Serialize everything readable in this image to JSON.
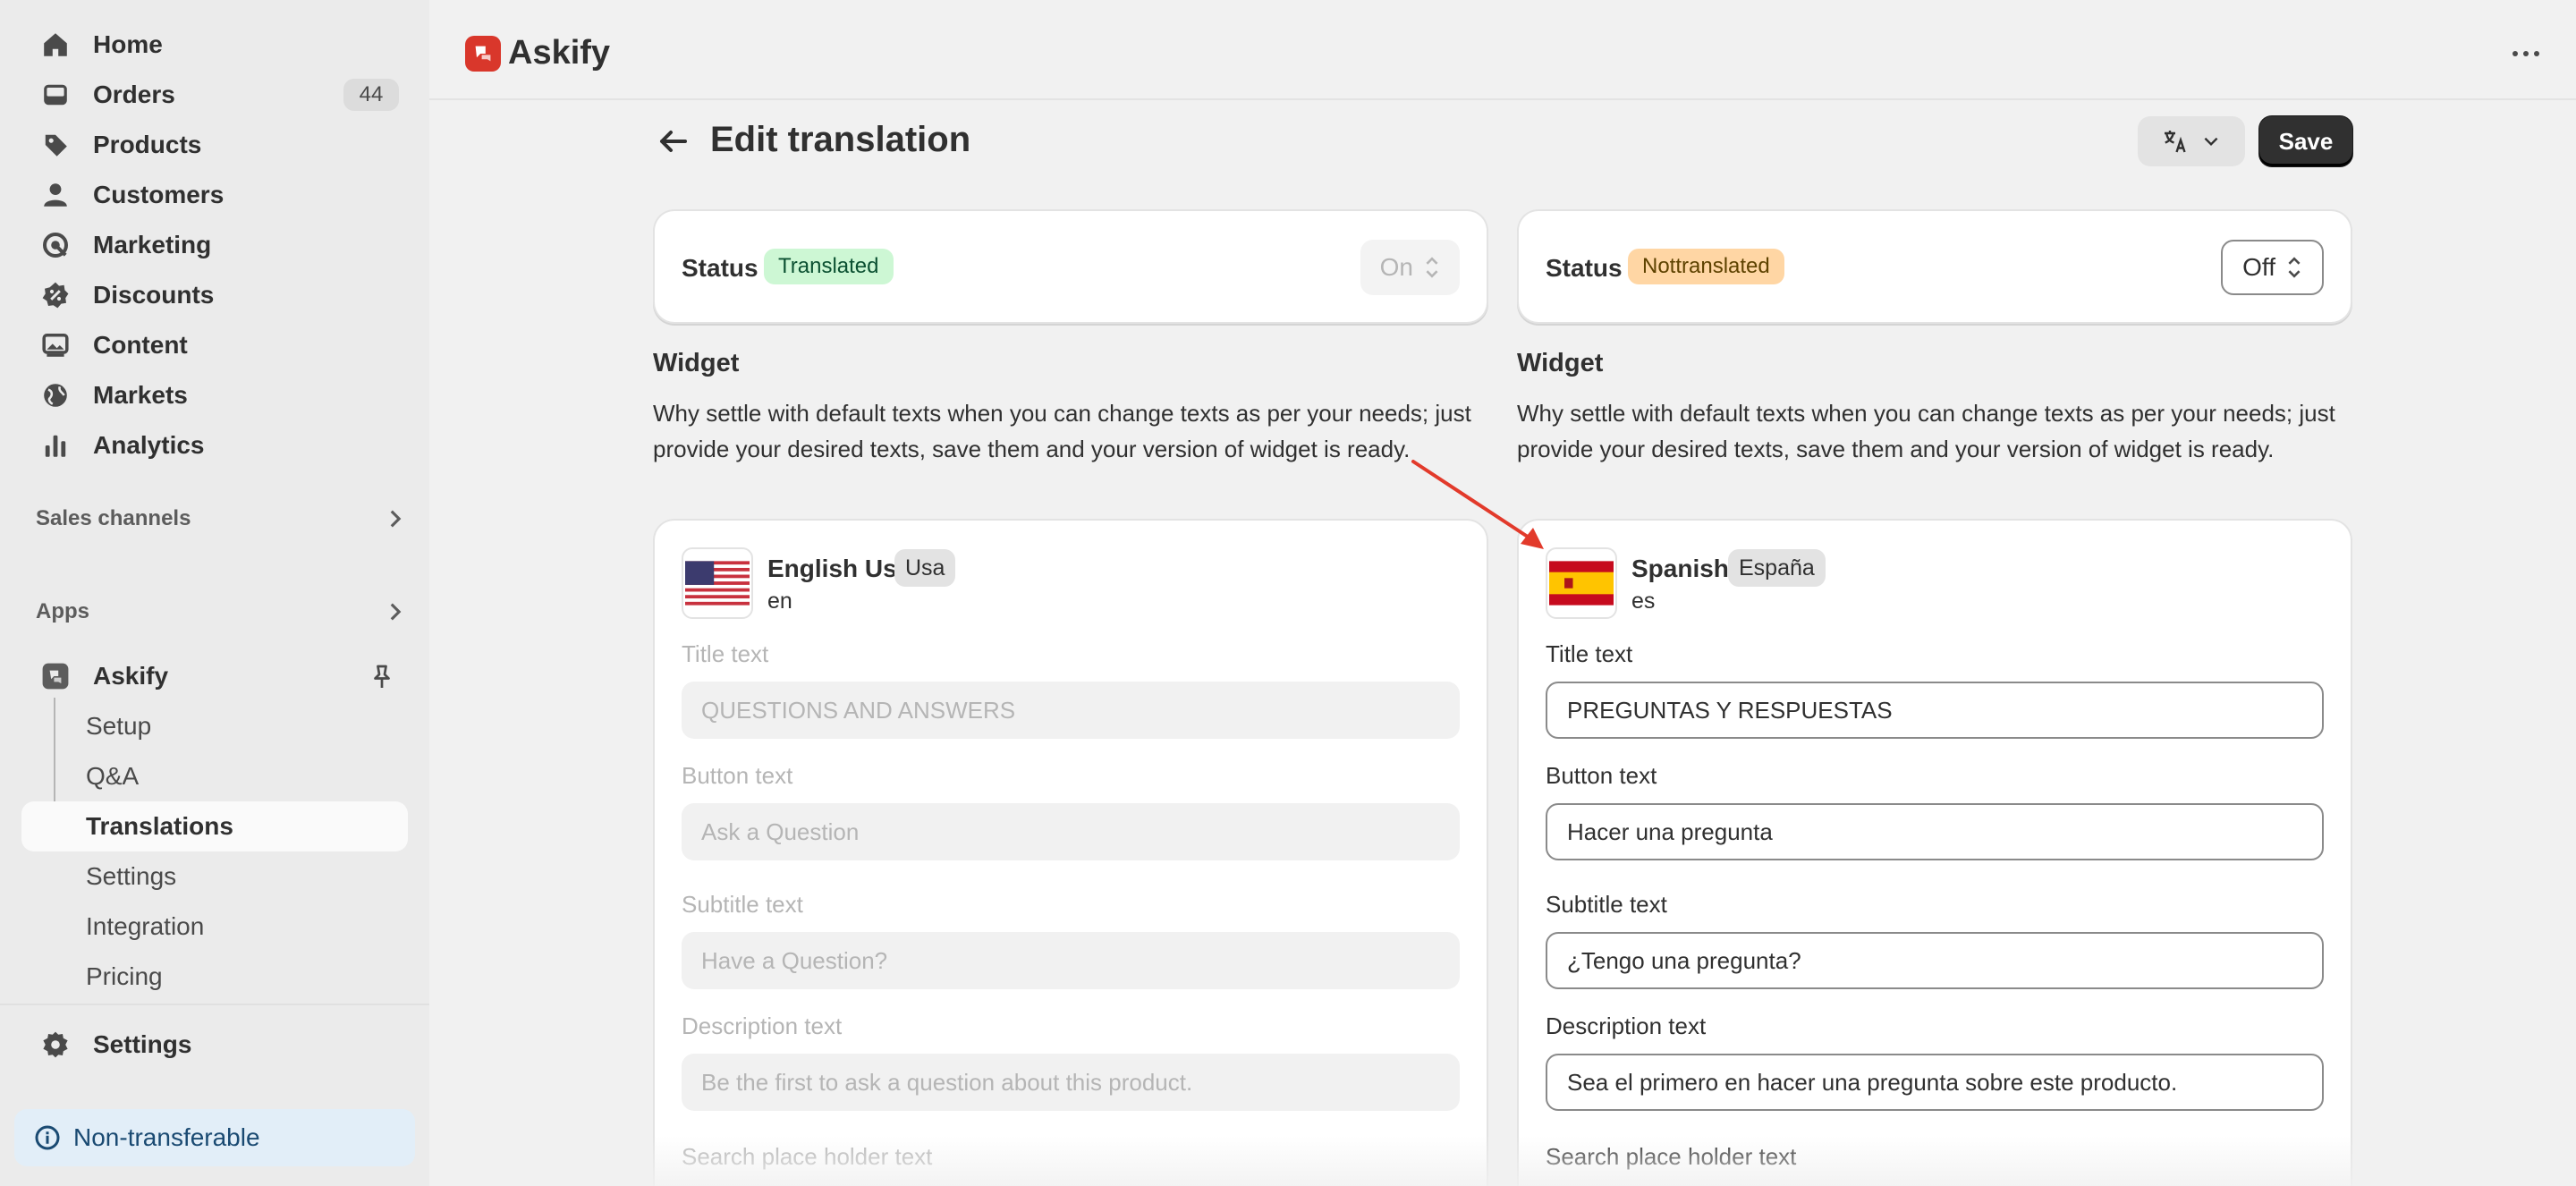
{
  "sidebar": {
    "nav": [
      {
        "label": "Home",
        "icon": "home-icon"
      },
      {
        "label": "Orders",
        "icon": "inbox-icon",
        "count": "44"
      },
      {
        "label": "Products",
        "icon": "tag-icon"
      },
      {
        "label": "Customers",
        "icon": "person-icon"
      },
      {
        "label": "Marketing",
        "icon": "target-icon"
      },
      {
        "label": "Discounts",
        "icon": "discount-icon"
      },
      {
        "label": "Content",
        "icon": "image-icon"
      },
      {
        "label": "Markets",
        "icon": "globe-icon"
      },
      {
        "label": "Analytics",
        "icon": "bar-chart-icon"
      }
    ],
    "sales_channels": "Sales channels",
    "apps": "Apps",
    "app_name": "Askify",
    "app_sub": [
      "Setup",
      "Q&A",
      "Translations",
      "Settings",
      "Integration",
      "Pricing"
    ],
    "settings": "Settings",
    "notice": "Non-transferable"
  },
  "topbar": {
    "app_title": "Askify"
  },
  "page": {
    "title": "Edit translation",
    "save": "Save"
  },
  "left": {
    "status_label": "Status",
    "status_pill": "Translated",
    "toggle": "On",
    "widget_heading": "Widget",
    "widget_desc": "Why settle with default texts when you can change texts as per your needs; just provide your desired texts, save them and your version of widget is ready.",
    "lang_name": "English Us",
    "lang_region": "Usa",
    "lang_code": "en",
    "fields": [
      {
        "label": "Title text",
        "value": "QUESTIONS AND ANSWERS"
      },
      {
        "label": "Button text",
        "value": "Ask a Question"
      },
      {
        "label": "Subtitle text",
        "value": "Have a Question?"
      },
      {
        "label": "Description text",
        "value": "Be the first to ask a question about this product."
      },
      {
        "label": "Search place holder text",
        "value": ""
      }
    ]
  },
  "right": {
    "status_label": "Status",
    "status_pill": "Nottranslated",
    "toggle": "Off",
    "widget_heading": "Widget",
    "widget_desc": "Why settle with default texts when you can change texts as per your needs; just provide your desired texts, save them and your version of widget is ready.",
    "lang_name": "Spanish",
    "lang_region": "España",
    "lang_code": "es",
    "fields": [
      {
        "label": "Title text",
        "value": "PREGUNTAS Y RESPUESTAS"
      },
      {
        "label": "Button text",
        "value": "Hacer una pregunta"
      },
      {
        "label": "Subtitle text",
        "value": "¿Tengo una pregunta?"
      },
      {
        "label": "Description text",
        "value": "Sea el primero en hacer una pregunta sobre este producto."
      },
      {
        "label": "Search place holder text",
        "value": ""
      }
    ]
  },
  "colors": {
    "accent_dark": "#303030",
    "brand_red": "#d9372b",
    "translated_bg": "#cdf7d4",
    "nottranslated_bg": "#ffd6a4",
    "annotation_arrow": "#e23a2b"
  }
}
